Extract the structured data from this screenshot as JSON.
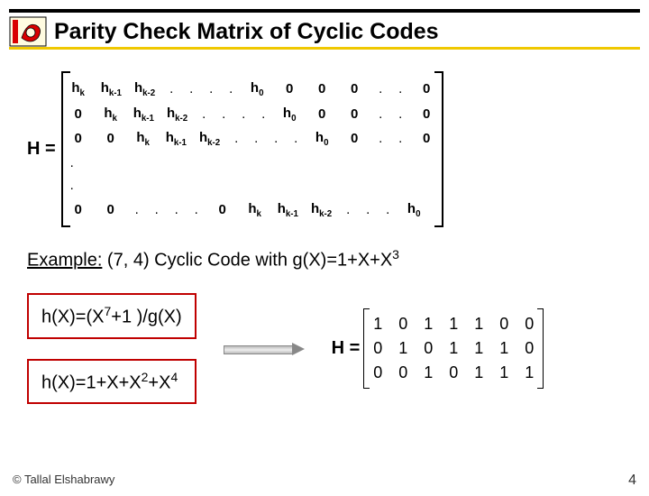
{
  "header": {
    "title": "Parity Check Matrix of Cyclic Codes"
  },
  "bigmatrix": {
    "label": "H =",
    "rows": [
      [
        "h_k",
        "h_{k-1}",
        "h_{k-2}",
        ".",
        ".",
        ".",
        ".",
        "h_0",
        "0",
        "0",
        "0",
        ".",
        ".",
        "0"
      ],
      [
        "0",
        "h_k",
        "h_{k-1}",
        "h_{k-2}",
        ".",
        ".",
        ".",
        ".",
        "h_0",
        "0",
        "0",
        ".",
        ".",
        "0"
      ],
      [
        "0",
        "0",
        "h_k",
        "h_{k-1}",
        "h_{k-2}",
        ".",
        ".",
        ".",
        ".",
        "h_0",
        "0",
        ".",
        ".",
        "0"
      ],
      [
        "."
      ],
      [
        "."
      ],
      [
        "0",
        "0",
        ".",
        ".",
        ".",
        ".",
        "0",
        "h_k",
        "h_{k-1}",
        "h_{k-2}",
        ".",
        ".",
        ".",
        "h_0"
      ]
    ]
  },
  "example": {
    "lead": "Example:",
    "text_a": " (7, 4) Cyclic Code with g(X)=1+X+X",
    "sup": "3"
  },
  "box1": {
    "a": "h(X)=(X",
    "sup": "7",
    "b": "+1 )/g(X)"
  },
  "box2": {
    "a": "h(X)=1+X+X",
    "sup1": "2",
    "b": "+X",
    "sup2": "4"
  },
  "smallmatrix": {
    "label": "H =",
    "rows": [
      [
        "1",
        "0",
        "1",
        "1",
        "1",
        "0",
        "0"
      ],
      [
        "0",
        "1",
        "0",
        "1",
        "1",
        "1",
        "0"
      ],
      [
        "0",
        "0",
        "1",
        "0",
        "1",
        "1",
        "1"
      ]
    ]
  },
  "footer": {
    "copyright": "© Tallal Elshabrawy",
    "page": "4"
  }
}
